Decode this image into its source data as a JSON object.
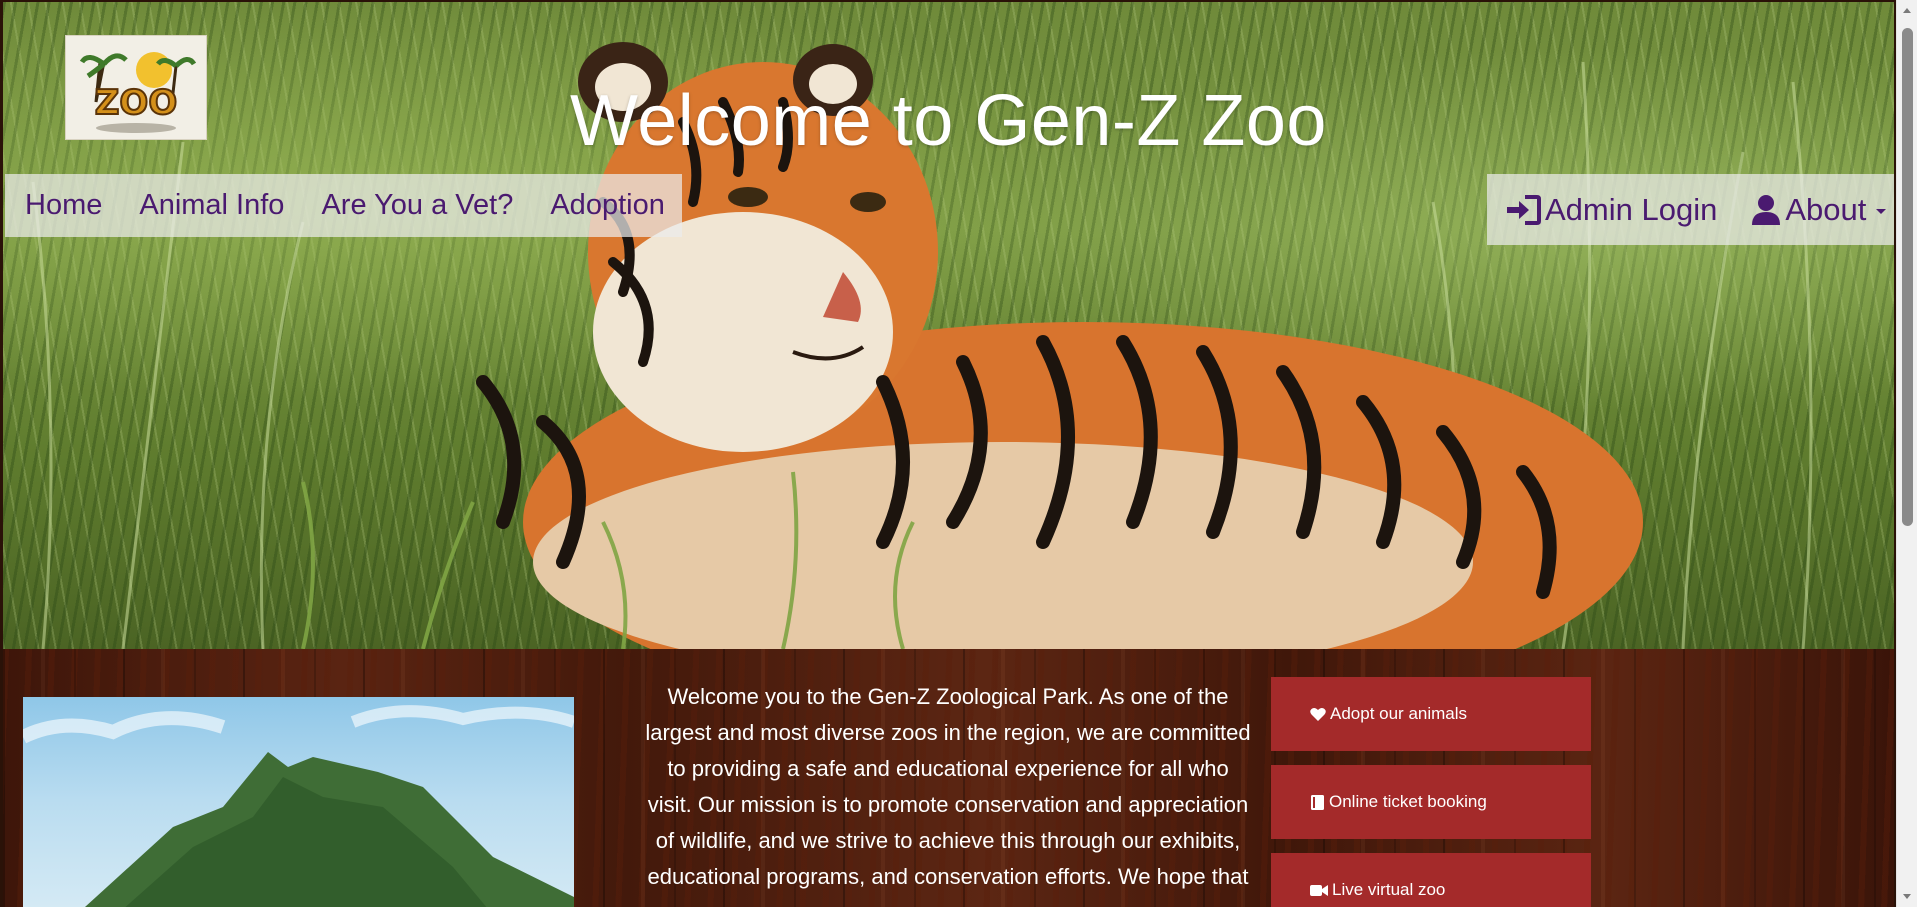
{
  "header": {
    "title": "Welcome to Gen-Z Zoo",
    "logo_text": "ZOO"
  },
  "nav": {
    "left": [
      {
        "label": "Home"
      },
      {
        "label": "Animal Info"
      },
      {
        "label": "Are You a Vet?"
      },
      {
        "label": "Adoption"
      }
    ],
    "right": {
      "admin_login": {
        "label": "Admin Login",
        "icon": "sign-in-icon"
      },
      "about": {
        "label": "About",
        "icon": "user-icon",
        "has_dropdown": true
      }
    }
  },
  "main": {
    "welcome_text": "Welcome you to the Gen-Z Zoological Park. As one of the largest and most diverse zoos in the region, we are committed to providing a safe and educational experience for all who visit. Our mission is to promote conservation and appreciation of wildlife, and we strive to achieve this through our exhibits, educational programs, and conservation efforts. We hope that your",
    "actions": [
      {
        "label": "Adopt our animals",
        "icon": "heart-icon"
      },
      {
        "label": "Online ticket booking",
        "icon": "book-icon"
      },
      {
        "label": "Live virtual zoo",
        "icon": "video-camera-icon"
      }
    ]
  },
  "colors": {
    "nav_text": "#4a1a70",
    "action_button": "#a42a2a",
    "title_text": "#ffffff"
  }
}
